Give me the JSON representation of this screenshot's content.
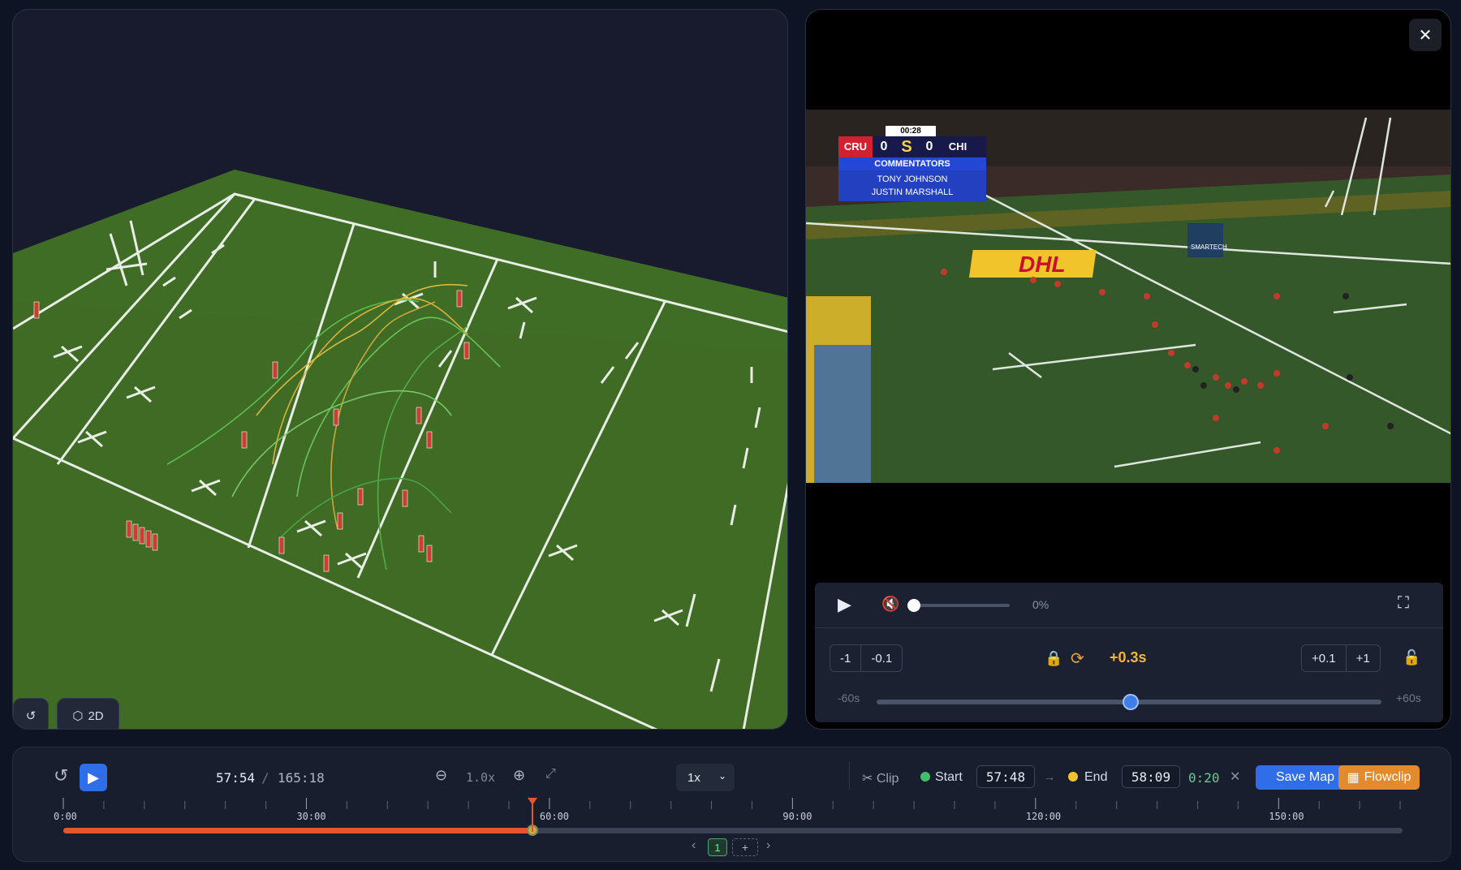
{
  "left_panel": {
    "view_mode_label": "2D",
    "reset_icon": "rotate-ccw-icon",
    "view_icon": "cube-icon"
  },
  "video": {
    "scoreboard": {
      "clock": "00:28",
      "home_team": "CRU",
      "home_score": "0",
      "logo": "S",
      "away_score": "0",
      "away_team": "CHI",
      "commentators_heading": "COMMENTATORS",
      "commentator_1": "TONY JOHNSON",
      "commentator_2": "JUSTIN MARSHALL"
    },
    "billboard_text": "DHL",
    "sponsor_logo": "SMARTECH",
    "controls": {
      "volume_percent": "0%",
      "volume_level": 0,
      "step_back_large": "-1",
      "step_back_small": "-0.1",
      "offset_value": "+0.3s",
      "step_forward_small": "+0.1",
      "step_forward_large": "+1",
      "range_min": "-60s",
      "range_max": "+60s",
      "offset_seconds": 0.3
    }
  },
  "timeline": {
    "current_time": "57:54",
    "separator": "/",
    "total_time": "165:18",
    "zoom_level": "1.0x",
    "speed": "1x",
    "clip_label": "Clip",
    "start_label": "Start",
    "start_time": "57:48",
    "arrow": "→",
    "end_label": "End",
    "end_time": "58:09",
    "duration": "0:20",
    "save_map_label": "Save Map",
    "flowclip_label": "Flowclip",
    "tick_labels": [
      "0:00",
      "30:00",
      "60:00",
      "90:00",
      "120:00",
      "150:00"
    ],
    "progress_fraction": 0.3503,
    "page_number": "1",
    "add_label": "+",
    "prev": "‹",
    "next": "›",
    "colors": {
      "accent_blue": "#2f6ee8",
      "progress_orange": "#e4572a",
      "flowclip_orange": "#e38a2c",
      "start_green": "#3fbf6a",
      "end_yellow": "#f2c232",
      "duration_green": "#6ec98d"
    }
  }
}
